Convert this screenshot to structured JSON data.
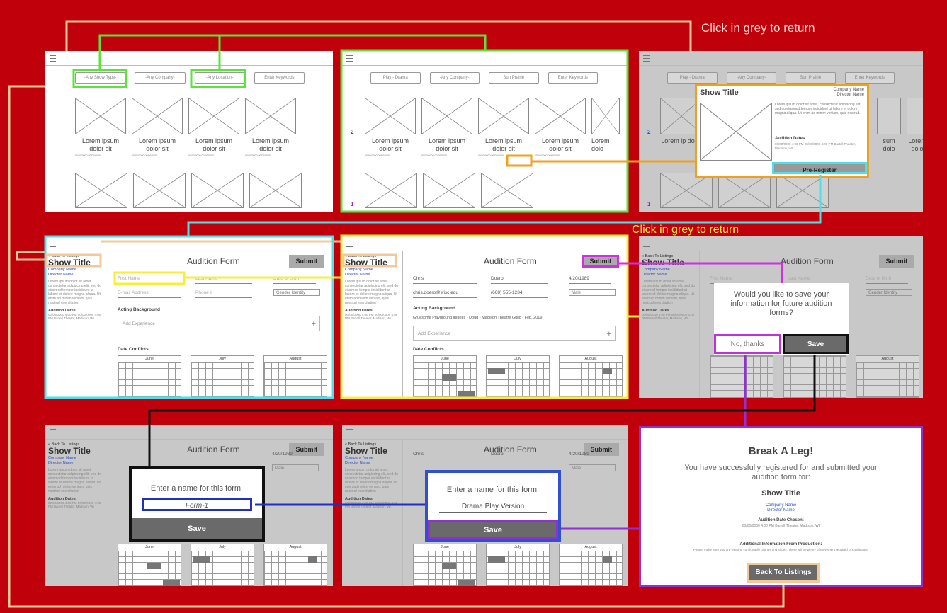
{
  "labels": {
    "return_top": "Click in grey to return",
    "return_mid": "Click in grey to return"
  },
  "filters_a": [
    "-Any Show Type-",
    "-Any Company-",
    "-Any Location-",
    "Enter Keywords"
  ],
  "filters_b": [
    "Play - Drama",
    "-Any Company-",
    "Sun Prairie",
    "Enter Keywords"
  ],
  "card": {
    "title": "Lorem ipsum dolor sit",
    "dates": "00/00/0000 00/00/0000"
  },
  "card_short": "Lorem ip dolor",
  "card_edge": "Lorem dolo",
  "card_edge2": "sum dolo",
  "pages": {
    "a": "2",
    "b": "1"
  },
  "popup": {
    "title": "Show Title",
    "company": "Company Name",
    "director": "Director Name",
    "text": "Lorem ipsum dolor sit amet, consectetur adipiscing elit, sed do eiusmod tempor incididunt ut labore et dolore magna aliqua. Ut enim ad minim veniam, quis nostrud.",
    "dates_head": "Audition Dates",
    "dates": "00/00/0000 4:00 PM 00/00/0000 4:00 PM Bartell Theater, Madison, WI",
    "button": "Pre-Register"
  },
  "form": {
    "back": "« Back To Listings",
    "show_title": "Show Title",
    "company": "Company Name",
    "director": "Director Name",
    "lorem": "Lorem ipsum dolor sit amet, consectetur adipiscing elit, sed do eiusmod tempor incididunt ut labore et dolore magna aliqua. Ut enim ad minim veniam, quis nostrud exercitation",
    "dates_head": "Audition Dates",
    "dates": "00/00/0000 4:00 PM 00/00/0000 4:00 PM Bartell Theater, Madison, WI",
    "heading": "Audition Form",
    "submit": "Submit",
    "first": "First Name",
    "last": "Last Name",
    "dob": "Date of Birth",
    "email": "E-mail Address",
    "phone": "Phone #",
    "gender": "Gender Identity",
    "acting": "Acting Background",
    "add_exp": "Add Experience",
    "conflicts": "Date Conflicts",
    "months": [
      "June",
      "July",
      "August"
    ]
  },
  "filled": {
    "first": "Chris",
    "last": "Doero",
    "dob": "4/20/1989",
    "email": "chris.doero@wisc.edu",
    "phone": "(608) 555-1234",
    "gender": "Male",
    "exp": "Gruesome Playground Injuries - Doug - Madison Theatre Guild - Feb. 2019"
  },
  "save_modal": {
    "question": "Would you like to save your information for future audition forms?",
    "no": "No, thanks",
    "save": "Save"
  },
  "name_modal_a": {
    "prompt": "Enter a name for this form:",
    "value": "Form-1",
    "save": "Save"
  },
  "name_modal_b": {
    "prompt": "Enter a name for this form:",
    "value": "Drama Play Version",
    "save": "Save"
  },
  "success": {
    "title": "Break A Leg!",
    "msg": "You have successfully registered for and submitted your audition form for:",
    "show": "Show Title",
    "company": "Company Name",
    "director": "Director Name",
    "date_head": "Audition Date Chosen:",
    "date": "00/00/0000 4:00 PM Bartell Theater, Madison, WI",
    "info_head": "Additional Information From Production:",
    "info": "Please make sure you are wearing comfortable clothes and shoes. There will be plenty of movement required of candidates.",
    "button": "Back To Listings"
  }
}
